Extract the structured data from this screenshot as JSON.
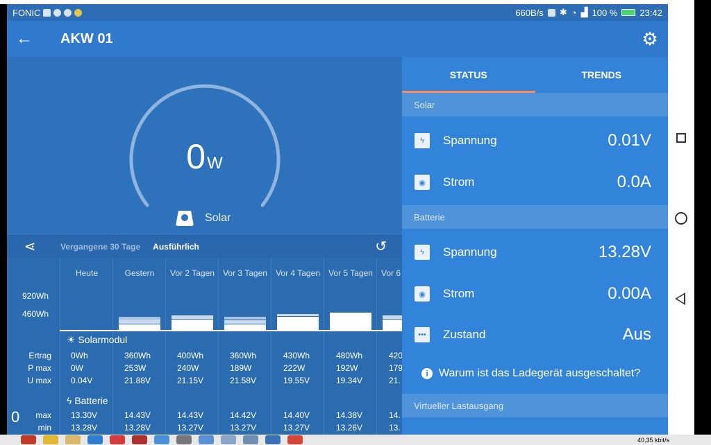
{
  "status_bar": {
    "carrier": "FONIC",
    "net_speed": "660B/s",
    "battery": "100 %",
    "time": "23:42"
  },
  "app_bar": {
    "title": "AKW 01"
  },
  "gauge": {
    "value": "0",
    "unit": "W",
    "label": "Solar"
  },
  "history": {
    "tab_30": "Vergangene 30 Tage",
    "tab_detail": "Ausführlich"
  },
  "table": {
    "y_labels": [
      "920Wh",
      "460Wh"
    ],
    "columns": [
      "Heute",
      "Gestern",
      "Vor 2 Tagen",
      "Vor 3 Tagen",
      "Vor 4 Tagen",
      "Vor 5 Tagen",
      "Vor 6"
    ],
    "solar_section": "Solarmodul",
    "solar_rows": {
      "labels": [
        "Ertrag",
        "P max",
        "U max"
      ],
      "values": [
        [
          "0Wh",
          "0W",
          "0.04V"
        ],
        [
          "360Wh",
          "253W",
          "21.88V"
        ],
        [
          "400Wh",
          "240W",
          "21.15V"
        ],
        [
          "360Wh",
          "189W",
          "21.58V"
        ],
        [
          "430Wh",
          "222W",
          "19.55V"
        ],
        [
          "480Wh",
          "192W",
          "19.34V"
        ],
        [
          "420",
          "179",
          "21."
        ]
      ]
    },
    "battery_section": "Batterie",
    "battery_rows": {
      "labels": [
        "max",
        "min"
      ],
      "values": [
        [
          "13.30V",
          "13.28V"
        ],
        [
          "14.43V",
          "13.28V"
        ],
        [
          "14.43V",
          "13.27V"
        ],
        [
          "14.42V",
          "13.27V"
        ],
        [
          "14.40V",
          "13.27V"
        ],
        [
          "14.38V",
          "13.26V"
        ],
        [
          "14.",
          "13."
        ]
      ]
    },
    "left_value": "0"
  },
  "right": {
    "tabs": [
      "STATUS",
      "TRENDS"
    ],
    "solar_header": "Solar",
    "solar_voltage": {
      "label": "Spannung",
      "value": "0.01V"
    },
    "solar_current": {
      "label": "Strom",
      "value": "0.0A"
    },
    "battery_header": "Batterie",
    "battery_voltage": {
      "label": "Spannung",
      "value": "13.28V"
    },
    "battery_current": {
      "label": "Strom",
      "value": "0.00A"
    },
    "state": {
      "label": "Zustand",
      "value": "Aus"
    },
    "info": "Warum ist das Ladegerät ausgeschaltet?",
    "virtual_header": "Virtueller Lastausgang"
  },
  "taskbar": {
    "net": "40,35 kbit/s"
  }
}
